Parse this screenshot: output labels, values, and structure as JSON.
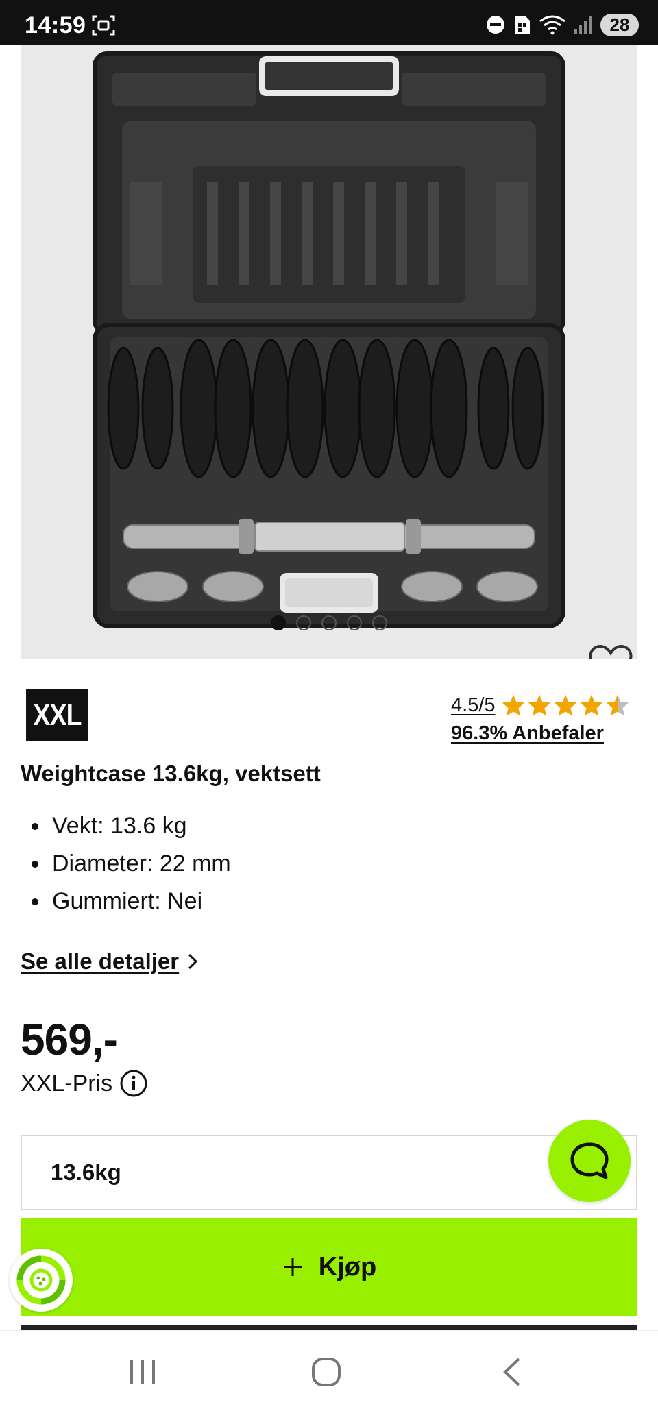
{
  "status_bar": {
    "time": "14:59",
    "battery": "28",
    "icons": [
      "screenshot-icon",
      "do-not-disturb-icon",
      "sim-icon",
      "wifi-icon",
      "signal-icon",
      "battery-icon"
    ]
  },
  "product": {
    "image_alt": "Weightcase with dumbbell bar and plates",
    "carousel": {
      "total_slides": 5,
      "active_slide": 1
    },
    "brand": "XXL",
    "rating": {
      "score_text": "4.5/5",
      "stars_value": 4.5,
      "stars_max": 5,
      "recommend_text": "96.3% Anbefaler"
    },
    "title": "Weightcase 13.6kg, vektsett",
    "specs": [
      "Vekt: 13.6 kg",
      "Diameter: 22 mm",
      "Gummiert: Nei"
    ],
    "details_link": "Se alle detaljer",
    "price": "569,-",
    "price_label": "XXL-Pris",
    "selected_variant": "13.6kg",
    "buy_label": "Kjøp"
  },
  "colors": {
    "accent": "#98f000",
    "dark": "#111111"
  }
}
